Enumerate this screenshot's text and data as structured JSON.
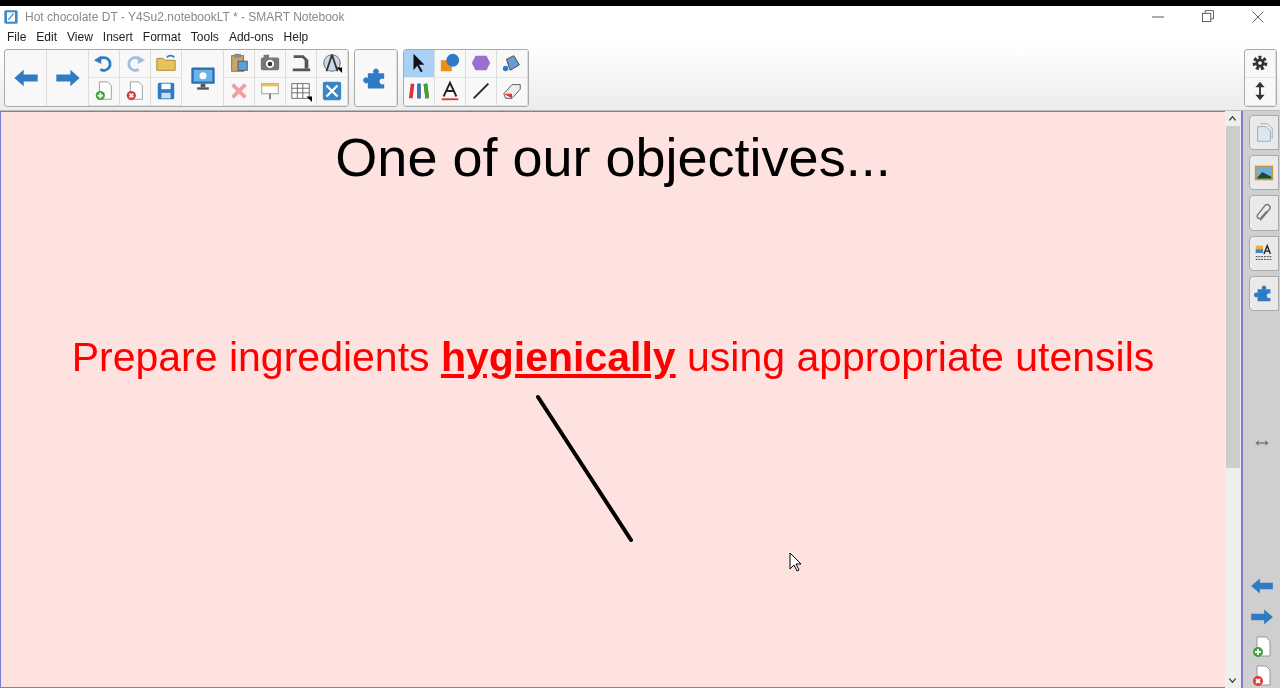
{
  "window": {
    "title": "Hot chocolate DT - Y4Su2.notebookLT * - SMART Notebook"
  },
  "menu": [
    "File",
    "Edit",
    "View",
    "Insert",
    "Format",
    "Tools",
    "Add-ons",
    "Help"
  ],
  "tools": [
    {
      "selected": true
    },
    {
      "selected": false
    },
    {
      "selected": false
    },
    {
      "selected": false
    },
    {
      "selected": false
    },
    {
      "selected": false
    },
    {
      "selected": false
    },
    {
      "selected": false
    }
  ],
  "slide": {
    "title": "One of our objectives...",
    "objective": "Prepare ingredients **hygienically** using appropriate utensils"
  }
}
